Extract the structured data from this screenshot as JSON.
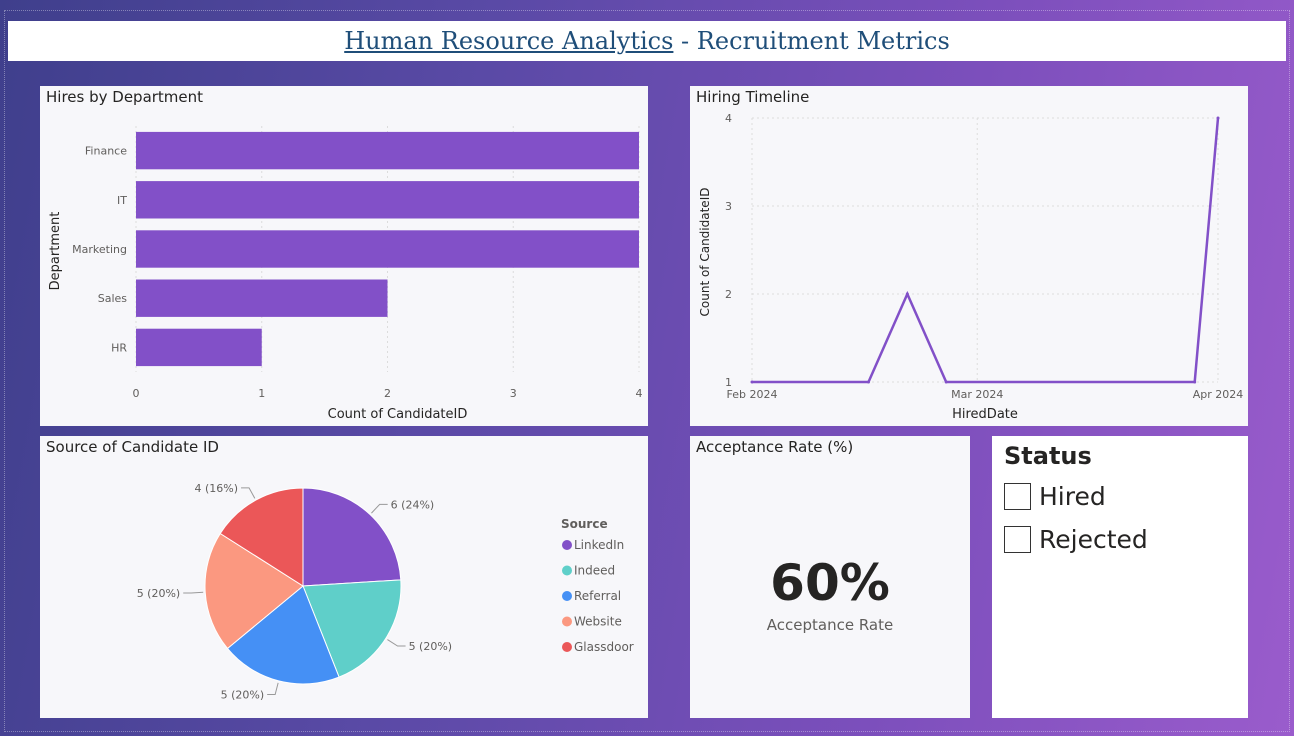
{
  "header": {
    "title_link": "Human Resource Analytics",
    "title_rest": " - Recruitment Metrics"
  },
  "hires_by_department": {
    "title": "Hires by Department",
    "chart_data": {
      "type": "bar",
      "orientation": "horizontal",
      "categories": [
        "Finance",
        "IT",
        "Marketing",
        "Sales",
        "HR"
      ],
      "values": [
        4,
        4,
        4,
        2,
        1
      ],
      "xlabel": "Count of CandidateID",
      "ylabel": "Department",
      "xlim": [
        0,
        4
      ],
      "x_ticks": [
        "0",
        "1",
        "2",
        "3",
        "4"
      ],
      "color": "#8250c8",
      "grid": true
    }
  },
  "hiring_timeline": {
    "title": "Hiring Timeline",
    "chart_data": {
      "type": "line",
      "x": [
        "2024-02-01",
        "2024-02-16",
        "2024-02-21",
        "2024-02-26",
        "2024-03-29",
        "2024-04-01"
      ],
      "y": [
        1,
        1,
        2,
        1,
        1,
        4
      ],
      "xlabel": "HiredDate",
      "ylabel": "Count of CandidateID",
      "ylim": [
        1,
        4
      ],
      "y_ticks": [
        "1",
        "2",
        "3",
        "4"
      ],
      "x_ticks": [
        "Feb 2024",
        "Mar 2024",
        "Apr 2024"
      ],
      "color": "#8250c8",
      "grid": true
    }
  },
  "source_chart": {
    "title": "Source of Candidate ID",
    "chart_data": {
      "type": "pie",
      "legend_title": "Source",
      "legend_position": "right",
      "slices": [
        {
          "name": "LinkedIn",
          "value": 6,
          "label": "6 (24%)",
          "color": "#8250c8"
        },
        {
          "name": "Indeed",
          "value": 5,
          "label": "5 (20%)",
          "color": "#5fcfc9"
        },
        {
          "name": "Referral",
          "value": 5,
          "label": "5 (20%)",
          "color": "#4590f5"
        },
        {
          "name": "Website",
          "value": 5,
          "label": "5 (20%)",
          "color": "#fb9880"
        },
        {
          "name": "Glassdoor",
          "value": 4,
          "label": "4 (16%)",
          "color": "#eb5758"
        }
      ]
    }
  },
  "acceptance_rate": {
    "title": "Acceptance Rate (%)",
    "value": "60%",
    "label": "Acceptance Rate"
  },
  "status_slicer": {
    "title": "Status",
    "options": [
      {
        "label": "Hired",
        "checked": false
      },
      {
        "label": "Rejected",
        "checked": false
      }
    ]
  }
}
